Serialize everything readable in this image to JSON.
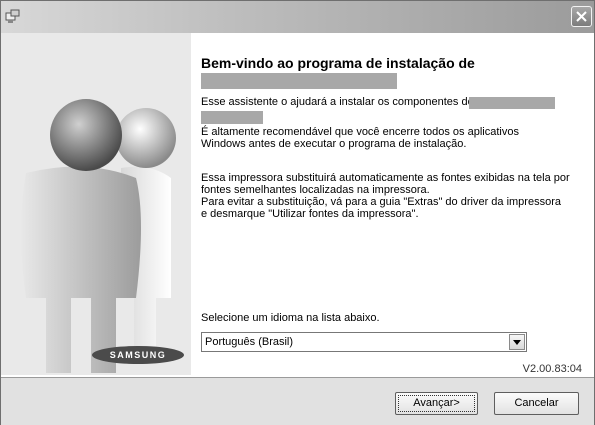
{
  "window": {
    "close_label": "✕"
  },
  "welcome": {
    "heading": "Bem-vindo ao programa de instalação de",
    "assistant_text": "Esse assistente o ajudará a instalar os componentes de",
    "close_apps_line1": "É altamente recomendável que você encerre todos os aplicativos",
    "close_apps_line2": "Windows antes de executar o programa de instalação.",
    "fonts_line1": "Essa impressora substituirá automaticamente as fontes exibidas na tela por",
    "fonts_line2": "fontes semelhantes localizadas na impressora.",
    "fonts_line3": "Para evitar a substituição, vá para a guia \"Extras\" do driver da impressora",
    "fonts_line4": "e desmarque \"Utilizar fontes da impressora\"."
  },
  "language": {
    "label": "Selecione um idioma na lista abaixo.",
    "selected": "Português (Brasil)"
  },
  "version": "V2.00.83:04",
  "brand": {
    "logo_text": "SAMSUNG"
  },
  "buttons": {
    "next": "Avançar>",
    "cancel": "Cancelar"
  },
  "colors": {
    "titlebar_light": "#d8d8d8",
    "titlebar_dark": "#9b9b9b",
    "redaction": "#a8a8a8",
    "footer": "#e1e1e1"
  }
}
